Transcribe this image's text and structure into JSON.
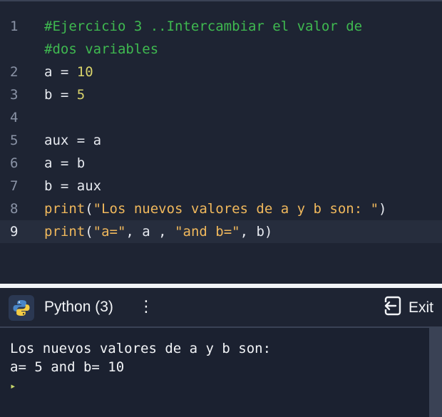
{
  "editor": {
    "lines": [
      {
        "n": "1",
        "parts": [
          {
            "t": "#Ejercicio 3 ..Intercambiar el valor de",
            "c": "cm"
          }
        ]
      },
      {
        "n": "",
        "parts": [
          {
            "t": "#dos variables",
            "c": "cm"
          }
        ]
      },
      {
        "n": "2",
        "parts": [
          {
            "t": "a = ",
            "c": ""
          },
          {
            "t": "10",
            "c": "num"
          }
        ]
      },
      {
        "n": "3",
        "parts": [
          {
            "t": "b = ",
            "c": ""
          },
          {
            "t": "5",
            "c": "num"
          }
        ]
      },
      {
        "n": "4",
        "parts": []
      },
      {
        "n": "5",
        "parts": [
          {
            "t": "aux = a",
            "c": ""
          }
        ]
      },
      {
        "n": "6",
        "parts": [
          {
            "t": "a = b",
            "c": ""
          }
        ]
      },
      {
        "n": "7",
        "parts": [
          {
            "t": "b = aux",
            "c": ""
          }
        ]
      },
      {
        "n": "8",
        "parts": [
          {
            "t": "print",
            "c": "fn"
          },
          {
            "t": "(",
            "c": ""
          },
          {
            "t": "\"Los nuevos valores de a y b son: \"",
            "c": "str"
          },
          {
            "t": ")",
            "c": ""
          }
        ]
      },
      {
        "n": "9",
        "parts": [
          {
            "t": "print",
            "c": "fn"
          },
          {
            "t": "(",
            "c": ""
          },
          {
            "t": "\"a=\"",
            "c": "str"
          },
          {
            "t": ", a , ",
            "c": ""
          },
          {
            "t": "\"and b=\"",
            "c": "str"
          },
          {
            "t": ", b)",
            "c": ""
          }
        ],
        "active": true
      }
    ]
  },
  "console": {
    "title": "Python (3)",
    "menu_glyph": "⋮",
    "exit_label": "Exit",
    "output": [
      "Los nuevos valores de a y b son:",
      "a= 5 and b= 10"
    ],
    "prompt_glyph": "▸"
  },
  "colors": {
    "comment": "#3fb950",
    "number": "#d9d36b",
    "string": "#f0b85c",
    "background": "#1e2433"
  },
  "icons": {
    "console_icon": "python-logo-icon",
    "exit_icon": "exit-door-icon",
    "menu_icon": "vertical-dots-icon"
  }
}
